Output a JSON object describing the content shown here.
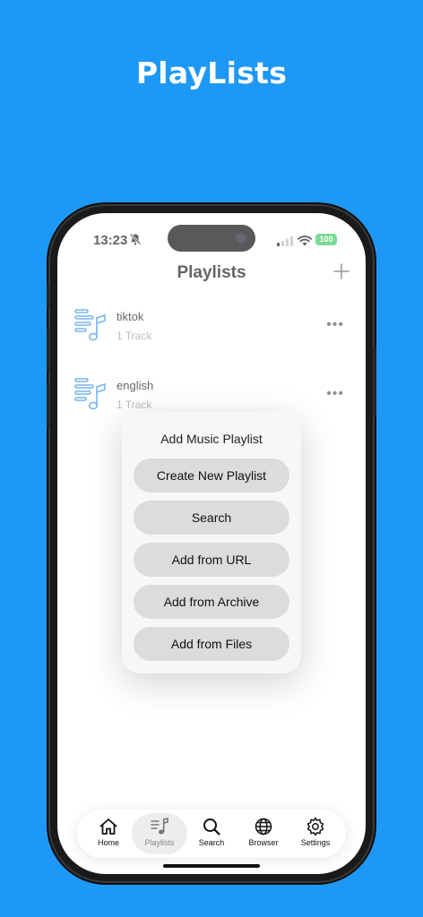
{
  "promo": {
    "title": "PlayLists"
  },
  "status_bar": {
    "time": "13:23",
    "battery": "100"
  },
  "header": {
    "title": "Playlists"
  },
  "playlists": [
    {
      "name": "tiktok",
      "count": "1 Track"
    },
    {
      "name": "english",
      "count": "1 Track"
    }
  ],
  "sheet": {
    "title": "Add Music Playlist",
    "options": [
      "Create New Playlist",
      "Search",
      "Add from URL",
      "Add from Archive",
      "Add from Files"
    ]
  },
  "tabs": [
    {
      "label": "Home",
      "icon": "home-icon"
    },
    {
      "label": "Playlists",
      "icon": "playlist-icon"
    },
    {
      "label": "Search",
      "icon": "search-icon"
    },
    {
      "label": "Browser",
      "icon": "globe-icon"
    },
    {
      "label": "Settings",
      "icon": "gear-icon"
    }
  ],
  "colors": {
    "background": "#1E98F5",
    "accent": "#2F8FE8",
    "battery": "#34C759"
  }
}
